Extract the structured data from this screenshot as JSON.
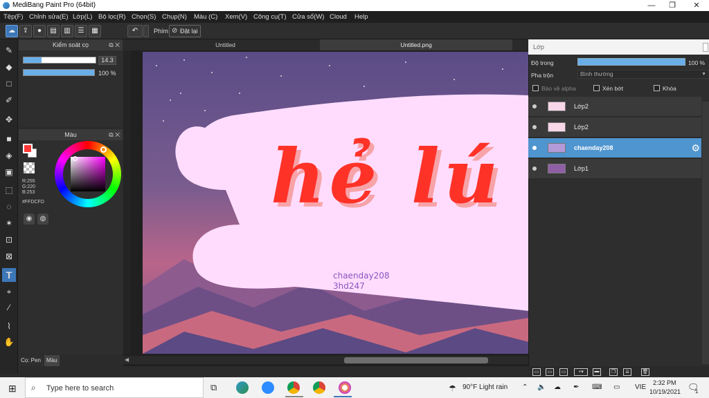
{
  "window": {
    "title": "MediBang Paint Pro (64bit)"
  },
  "menu": [
    "Tệp(F)",
    "Chỉnh sửa(E)",
    "Lớp(L)",
    "Bộ lọc(R)",
    "Chọn(S)",
    "Chụp(N)",
    "Màu (C)",
    "Xem(V)",
    "Công cụ(T)",
    "Cửa sổ(W)",
    "Cloud",
    "Help"
  ],
  "toolbar": {
    "keyboard_label": "Phím",
    "reset_label": "Đặt lại"
  },
  "brush_panel": {
    "title": "Kiểm soát cọ",
    "size_value": "14.3",
    "size_fraction": 0.25,
    "opacity_value": "100 %",
    "opacity_fraction": 1.0
  },
  "color_panel": {
    "title": "Màu",
    "fg_color": "#FF3737",
    "r": "R:255",
    "g": "G:220",
    "b": "B:253",
    "hex": "#FFDCFD"
  },
  "panel_tabs": {
    "brush_tab": "Cọ: Pen",
    "color_tab": "Màu"
  },
  "doc_tabs": [
    "Untitled",
    "Untitled.png"
  ],
  "canvas": {
    "headline": "hẻ lú ~",
    "line1": "chaenday208",
    "line2": "3hd247"
  },
  "layers_panel": {
    "title": "Lớp",
    "opacity_label": "Độ trong",
    "opacity_value": "100 %",
    "opacity_fraction": 1.0,
    "blend_label": "Pha trộn",
    "blend_value": "Bình thường",
    "protect_alpha": "Bảo vệ alpha",
    "clipping": "Xén bớt",
    "lock": "Khóa",
    "layers": [
      {
        "name": "Lớp2",
        "selected": false
      },
      {
        "name": "Lớp2",
        "selected": false
      },
      {
        "name": "chaenday208",
        "selected": true
      },
      {
        "name": "Lớp1",
        "selected": false
      }
    ]
  },
  "taskbar": {
    "search_placeholder": "Type here to search",
    "weather": "90°F  Light rain",
    "lang": "VIE",
    "time": "2:32 PM",
    "date": "10/19/2021",
    "notif_count": "1"
  }
}
